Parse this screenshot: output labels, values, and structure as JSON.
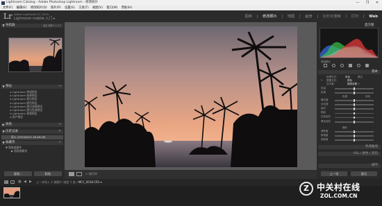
{
  "window": {
    "title": "Lightroom Catalog - Adobe Photoshop Lightroom - 修改照片",
    "controls": [
      "—",
      "❐",
      "✕"
    ]
  },
  "menu": [
    "文件(F)",
    "编辑(E)",
    "修改照片(D)",
    "照片(P)",
    "设置(S)",
    "工具(T)",
    "视图(V)",
    "窗口(W)",
    "帮助(H)"
  ],
  "identity": {
    "logo": "Lr",
    "line1": "Adobe Lightroom CC 2015",
    "line2": "Lightroom mobile 入门 ▸"
  },
  "modules": {
    "items": [
      "图库",
      "修改照片",
      "地图",
      "画册",
      "幻灯片放映",
      "打印",
      "Web"
    ],
    "active_index": 1
  },
  "left_panel": {
    "navigator": {
      "title": "导航器",
      "zoom": "适合  填满  1:1  3:1"
    },
    "presets": {
      "title": "预设",
      "items": [
        "Lightroom 常规预设",
        "Lightroom 效果预设",
        "Lightroom 黑白预设",
        "Lightroom 颜色预设",
        "Lightroom 黑白滤镜预设",
        "Lightroom 黑白色调预设",
        "Lightroom 视频预设",
        "用户预设"
      ]
    },
    "snapshots": {
      "title": "快照"
    },
    "history": {
      "title": "历史记录",
      "selected": "导入 (2015/6/15 16:46:28)"
    },
    "collections": {
      "title": "收藏夹",
      "items": [
        "智能收藏夹",
        "智能收藏夹"
      ]
    },
    "buttons": {
      "copy": "复制...",
      "paste": "粘贴"
    }
  },
  "toolbar": {
    "softproof": "软打样"
  },
  "right_panel": {
    "histogram_title": "直方图",
    "histogram_colors": {
      "red": "#e0383a",
      "green": "#3ac24a",
      "blue": "#3a6ee8",
      "lum": "#cfcfcf"
    },
    "original_label": "原始照片",
    "basic_title": "基本",
    "treatment": {
      "label": "处理方式：",
      "color": "彩色",
      "bw": "黑白"
    },
    "profile": {
      "label": "配置文件：",
      "value": "颜色"
    },
    "wb": {
      "label": "白平衡：",
      "value": "原照设置 ÷"
    },
    "sliders_a": [
      {
        "label": "色温",
        "pos": 0.5
      },
      {
        "label": "色调",
        "pos": 0.5
      }
    ],
    "tone_title": "色调",
    "auto_label": "自动",
    "sliders_b": [
      {
        "label": "曝光度",
        "pos": 0.5
      },
      {
        "label": "对比度",
        "pos": 0.5
      },
      {
        "label": "高光",
        "pos": 0.5
      },
      {
        "label": "阴影",
        "pos": 0.5
      },
      {
        "label": "白色色阶",
        "pos": 0.5
      },
      {
        "label": "黑色色阶",
        "pos": 0.5
      }
    ],
    "presence_title": "偏好",
    "sliders_c": [
      {
        "label": "清晰度",
        "pos": 0.5
      },
      {
        "label": "鲜艳度",
        "pos": 0.5
      },
      {
        "label": "饱和度",
        "pos": 0.5
      }
    ],
    "collapsed": [
      "色调曲线",
      "HSL / 颜色 / 黑白",
      "细节"
    ],
    "buttons": {
      "prev": "上一张",
      "reset": "复位"
    }
  },
  "filmstrip": {
    "page1": "1",
    "page2": "2",
    "path": "上一次导入   1 张照片 /选定 1 张 /",
    "filename": "MCC_0018.CR2 ▾",
    "filter_label": "过滤器："
  },
  "watermark": {
    "badge": "Z",
    "line1": "中关村在线",
    "line2": "ZOL.COM.CN"
  }
}
